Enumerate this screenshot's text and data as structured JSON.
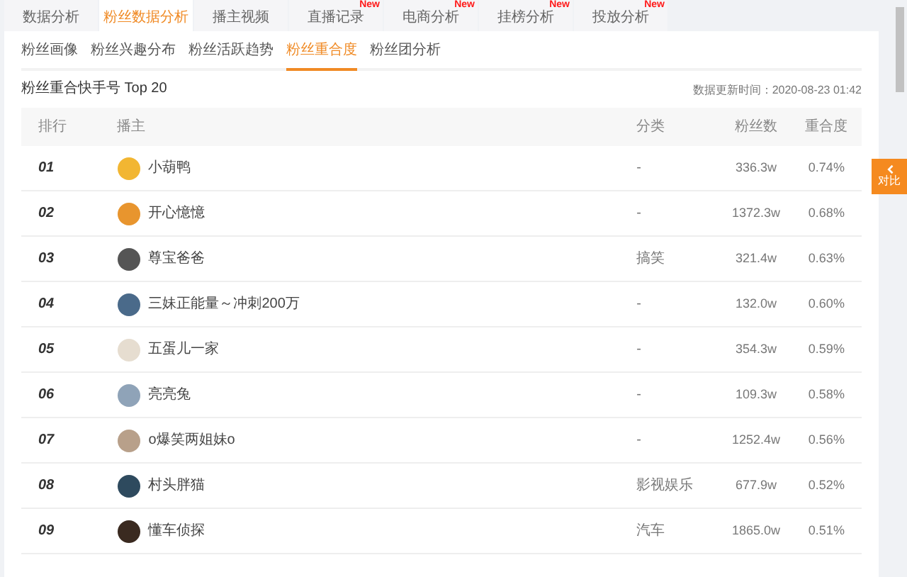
{
  "top_tabs": [
    {
      "label": "数据分析",
      "selected": false
    },
    {
      "label": "粉丝数据分析",
      "selected": true
    },
    {
      "label": "播主视频",
      "selected": false
    },
    {
      "label": "直播记录",
      "selected": false,
      "badge": "New"
    },
    {
      "label": "电商分析",
      "selected": false,
      "badge": "New"
    },
    {
      "label": "挂榜分析",
      "selected": false,
      "badge": "New"
    },
    {
      "label": "投放分析",
      "selected": false,
      "badge": "New"
    }
  ],
  "sub_tabs": [
    {
      "label": "粉丝画像",
      "selected": false
    },
    {
      "label": "粉丝兴趣分布",
      "selected": false
    },
    {
      "label": "粉丝活跃趋势",
      "selected": false
    },
    {
      "label": "粉丝重合度",
      "selected": true
    },
    {
      "label": "粉丝团分析",
      "selected": false
    }
  ],
  "section_title": "粉丝重合快手号 Top 20",
  "update_time": "数据更新时间：2020-08-23 01:42",
  "table": {
    "columns": [
      "排行",
      "播主",
      "分类",
      "粉丝数",
      "重合度"
    ],
    "rows": [
      {
        "rank": "01",
        "name": "小葫鸭",
        "category": "-",
        "fans": "336.3w",
        "overlap": "0.74%",
        "color": "#f2b632"
      },
      {
        "rank": "02",
        "name": "开心憶憶",
        "category": "-",
        "fans": "1372.3w",
        "overlap": "0.68%",
        "color": "#e8952e"
      },
      {
        "rank": "03",
        "name": "尊宝爸爸",
        "category": "搞笑",
        "fans": "321.4w",
        "overlap": "0.63%",
        "color": "#555555"
      },
      {
        "rank": "04",
        "name": "三妹正能量～冲刺200万",
        "category": "-",
        "fans": "132.0w",
        "overlap": "0.60%",
        "color": "#4a6a8a"
      },
      {
        "rank": "05",
        "name": "五蛋儿一家",
        "category": "-",
        "fans": "354.3w",
        "overlap": "0.59%",
        "color": "#e6ddd0"
      },
      {
        "rank": "06",
        "name": "亮亮兔",
        "category": "-",
        "fans": "109.3w",
        "overlap": "0.58%",
        "color": "#8fa3b8"
      },
      {
        "rank": "07",
        "name": "o爆笑两姐妹o",
        "category": "-",
        "fans": "1252.4w",
        "overlap": "0.56%",
        "color": "#b8a08a"
      },
      {
        "rank": "08",
        "name": "村头胖猫",
        "category": "影视娱乐",
        "fans": "677.9w",
        "overlap": "0.52%",
        "color": "#2e4a5e"
      },
      {
        "rank": "09",
        "name": "懂车侦探",
        "category": "汽车",
        "fans": "1865.0w",
        "overlap": "0.51%",
        "color": "#3a2a20"
      }
    ]
  },
  "compare_button": {
    "label": "对比"
  }
}
